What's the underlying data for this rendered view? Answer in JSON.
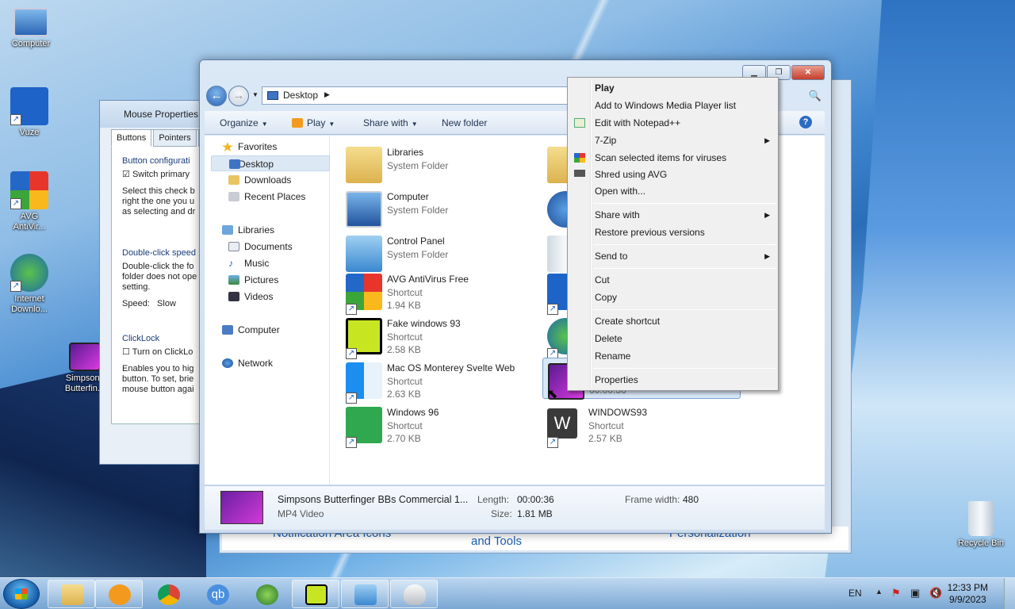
{
  "desktop": {
    "icons": [
      {
        "label": "Computer"
      },
      {
        "label": "Vuze"
      },
      {
        "label": "AVG AntiVir..."
      },
      {
        "label": "Internet Downlo..."
      },
      {
        "label": "Simpsons Butterfin..."
      },
      {
        "label": "Recycle Bin"
      }
    ]
  },
  "mouse_window": {
    "title": "Mouse Properties",
    "tabs": [
      "Buttons",
      "Pointers",
      "P"
    ],
    "button_config": {
      "title": "Button configurati",
      "checkbox": "Switch primary",
      "desc": [
        "Select this check b",
        "right the one you u",
        "as selecting and dr"
      ]
    },
    "dblclick": {
      "title": "Double-click speed",
      "desc": [
        "Double-click the fo",
        "folder does not ope",
        "setting."
      ],
      "speed_label": "Speed:",
      "slow_label": "Slow"
    },
    "clicklock": {
      "title": "ClickLock",
      "checkbox": "Turn on ClickLo",
      "desc": [
        "Enables you to hig",
        "button. To set, brie",
        "mouse button agai"
      ]
    }
  },
  "cp_window": {
    "items": [
      "Notification Area Icons",
      "and Tools",
      "Personalization"
    ]
  },
  "explorer": {
    "address": "Desktop",
    "toolbar": {
      "organize": "Organize",
      "play": "Play",
      "share": "Share with",
      "newfolder": "New folder"
    },
    "nav": {
      "favorites": "Favorites",
      "desktop": "Desktop",
      "downloads": "Downloads",
      "recent": "Recent Places",
      "libraries": "Libraries",
      "documents": "Documents",
      "music": "Music",
      "pictures": "Pictures",
      "videos": "Videos",
      "computer": "Computer",
      "network": "Network"
    },
    "files": [
      {
        "name": "Libraries",
        "line1": "System Folder",
        "line2": ""
      },
      {
        "name": "Computer",
        "line1": "System Folder",
        "line2": ""
      },
      {
        "name": "Control Panel",
        "line1": "System Folder",
        "line2": ""
      },
      {
        "name": "AVG AntiVirus Free",
        "line1": "Shortcut",
        "line2": "1.94 KB"
      },
      {
        "name": "Fake windows 93",
        "line1": "Shortcut",
        "line2": "2.58 KB"
      },
      {
        "name": "Mac OS Monterey Svelte Web",
        "line1": "Shortcut",
        "line2": "2.63 KB"
      },
      {
        "name": "Windows 96",
        "line1": "Shortcut",
        "line2": "2.70 KB"
      },
      {
        "name": "WINDOWS93",
        "line1": "Shortcut",
        "line2": "2.57 KB"
      },
      {
        "name": "",
        "line1": "00:00:36",
        "line2": ""
      }
    ],
    "details": {
      "title": "Simpsons Butterfinger BBs Commercial 1...",
      "type": "MP4 Video",
      "length_label": "Length:",
      "length": "00:00:36",
      "size_label": "Size:",
      "size": "1.81 MB",
      "frame_label": "Frame width:",
      "frame": "480"
    }
  },
  "context_menu": {
    "items": [
      "Play",
      "Add to Windows Media Player list",
      "Edit with Notepad++",
      "7-Zip",
      "Scan selected items for viruses",
      "Shred using AVG",
      "Open with...",
      "Share with",
      "Restore previous versions",
      "Send to",
      "Cut",
      "Copy",
      "Create shortcut",
      "Delete",
      "Rename",
      "Properties"
    ]
  },
  "taskbar": {
    "lang": "EN",
    "time": "12:33 PM",
    "date": "9/9/2023",
    "qb_label": "qb"
  }
}
